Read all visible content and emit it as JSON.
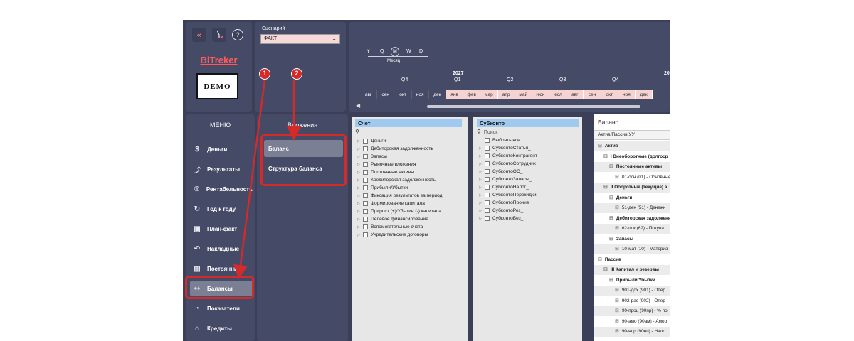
{
  "toolbar": {
    "icons": [
      "collapse-icon",
      "filter-clear-icon",
      "help-icon"
    ],
    "collapse_glyph": "«",
    "filter_glyph": "⚲",
    "help_glyph": "?"
  },
  "brand": "BiTreker",
  "demo_logo": "DEMO",
  "scenario": {
    "label": "Сценарий",
    "value": "ФАКТ"
  },
  "timeline": {
    "granularity": [
      "Y",
      "Q",
      "M",
      "W",
      "D"
    ],
    "selected_caption": "Месяц",
    "year_2027": "2027",
    "year_next": "20",
    "q4_left": "Q4",
    "q1": "Q1",
    "q2": "Q2",
    "q3": "Q3",
    "q4_right": "Q4",
    "months": [
      "авг",
      "сен",
      "окт",
      "ноя",
      "дек",
      "янв",
      "фев",
      "мар",
      "апр",
      "май",
      "июн",
      "июл",
      "авг",
      "сен",
      "окт",
      "ноя",
      "дек"
    ]
  },
  "menu": {
    "title": "МЕНЮ",
    "items": [
      {
        "label": "Деньги",
        "icon": "$"
      },
      {
        "label": "Результаты",
        "icon": "⤴"
      },
      {
        "label": "Рентабельность",
        "icon": "®"
      },
      {
        "label": "Год к году",
        "icon": "↻"
      },
      {
        "label": "План-факт",
        "icon": "▣"
      },
      {
        "label": "Накладные",
        "icon": "↶"
      },
      {
        "label": "Постоянные",
        "icon": "▥"
      },
      {
        "label": "Балансы",
        "icon": "⇿"
      },
      {
        "label": "Показатели",
        "icon": "◔"
      },
      {
        "label": "Кредиты",
        "icon": "⌂"
      }
    ]
  },
  "submenu": {
    "title": "Вложения",
    "items": [
      "Баланс",
      "Структура баланса"
    ]
  },
  "account": {
    "header": "Счет",
    "items": [
      "Деньги",
      "Дебиторская задолженность",
      "Запасы",
      "Рыночные вложения",
      "Постоянные активы",
      "Кредиторская задолженность",
      "Прибыли/Убытки",
      "Фиксация результатов за период",
      "Формирование капитала",
      "Прирост (+)/Убытие (-) капитала",
      "Целевое финансирование",
      "Вспомогательные счета",
      "Учредительские договоры"
    ]
  },
  "subkonto": {
    "header": "Субконто",
    "placeholder": "Поиск",
    "items": [
      "Выбрать все",
      "СубконтоСтатья_",
      "СубконтоКонтрагент_",
      "СубконтоСотрудник_",
      "СубконтоОС_",
      "СубконтоЗапасы_",
      "СубконтоНалог_",
      "СубконтоПерекидки_",
      "СубконтоПрочие_",
      "СубконтоРез_",
      "СубконтоБез_"
    ]
  },
  "balance": {
    "title": "Баланс",
    "subheader": "Актив/Пассив.УУ",
    "rows": [
      {
        "text": "Актив",
        "pm": "⊟",
        "indent": 6,
        "bold": true,
        "shade": true
      },
      {
        "text": "I Внеоборотные (долгоср",
        "pm": "⊟",
        "indent": 14,
        "bold": true,
        "shade": false
      },
      {
        "text": "Постоянные активы",
        "pm": "⊟",
        "indent": 22,
        "bold": true,
        "shade": true
      },
      {
        "text": "01-осн (01) - Основные",
        "pm": "⊞",
        "indent": 30,
        "bold": false,
        "shade": false
      },
      {
        "text": "II Оборотные (текущие) а",
        "pm": "⊟",
        "indent": 14,
        "bold": true,
        "shade": true
      },
      {
        "text": "Деньги",
        "pm": "⊟",
        "indent": 22,
        "bold": true,
        "shade": false
      },
      {
        "text": "51-ден (51) - Денежн",
        "pm": "⊞",
        "indent": 30,
        "bold": false,
        "shade": true
      },
      {
        "text": "Дебиторская задолженн",
        "pm": "⊟",
        "indent": 22,
        "bold": true,
        "shade": false
      },
      {
        "text": "62-пок (62) - Покупат",
        "pm": "⊞",
        "indent": 30,
        "bold": false,
        "shade": true
      },
      {
        "text": "Запасы",
        "pm": "⊟",
        "indent": 22,
        "bold": true,
        "shade": false
      },
      {
        "text": "10-мат (10) - Материа",
        "pm": "⊞",
        "indent": 30,
        "bold": false,
        "shade": true
      },
      {
        "text": "Пассив",
        "pm": "⊟",
        "indent": 6,
        "bold": true,
        "shade": false
      },
      {
        "text": "III Капитал и резервы",
        "pm": "⊟",
        "indent": 14,
        "bold": true,
        "shade": true
      },
      {
        "text": "Прибыли/Убытки",
        "pm": "⊟",
        "indent": 22,
        "bold": true,
        "shade": false
      },
      {
        "text": "901-дох (901) - Опер",
        "pm": "⊞",
        "indent": 30,
        "bold": false,
        "shade": true
      },
      {
        "text": "902-рас (902) - Опер",
        "pm": "⊞",
        "indent": 30,
        "bold": false,
        "shade": false
      },
      {
        "text": "90-проц (90пр) - % по",
        "pm": "⊞",
        "indent": 30,
        "bold": false,
        "shade": true
      },
      {
        "text": "90-амо (90ам) - Амор",
        "pm": "⊞",
        "indent": 30,
        "bold": false,
        "shade": false
      },
      {
        "text": "90-нпр (90нп) - Нало",
        "pm": "⊞",
        "indent": 30,
        "bold": false,
        "shade": true
      }
    ]
  },
  "annotations": {
    "step1": "1",
    "step2": "2",
    "color": "#d42a2a"
  }
}
